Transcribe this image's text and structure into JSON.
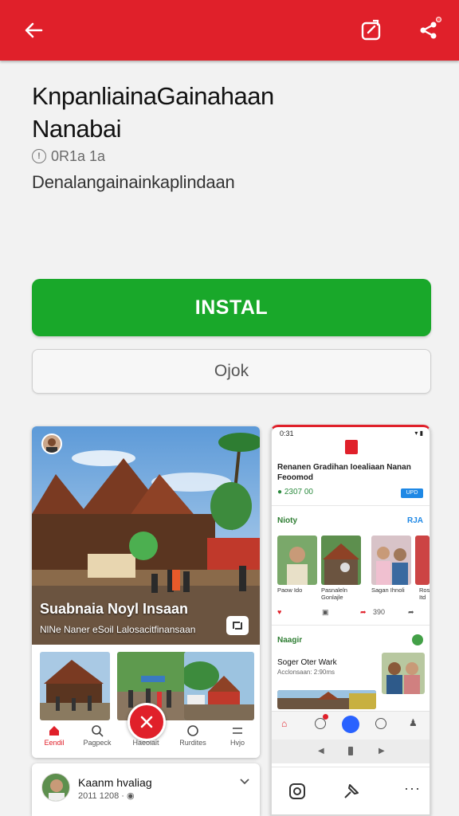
{
  "colors": {
    "accent": "#e0202a",
    "install_green": "#19a82a",
    "link_blue": "#1e88e5"
  },
  "toolbar": {
    "back_icon": "arrow-left-icon",
    "edit_icon": "edit-square-icon",
    "share_icon": "share-icon"
  },
  "app": {
    "title_line1": "KnpanliainaGainahaan",
    "title_line2": "Nanabai",
    "meta": "0R1a 1a",
    "subtitle": "Denalangainainkaplindaan"
  },
  "actions": {
    "install_label": "INSTAL",
    "open_label": "Ojok"
  },
  "screenshot1": {
    "hero_title": "Suabnaia Noyl Insaan",
    "hero_subtitle": "NlNe Naner eSoil Lalosacitfinansaan",
    "nav": [
      "Eendil",
      "Pagpeck",
      "Haeolait",
      "Rurdites",
      "Hvjo"
    ]
  },
  "screenshot2": {
    "status_time": "0:31",
    "status_right": "▾ ▮",
    "app_name": "Renanen Gradihan Ioealiaan Nanan Feoomod",
    "rating": "2307 00",
    "badge": "UPD",
    "section1": "Nioty",
    "section1_link": "RJA",
    "captions": [
      "Paow Ido",
      "Pasnaleln Gonlajle",
      "Sagan Ihnoli",
      "Rosa Itd"
    ],
    "acts_count": "390",
    "section2": "Naagir",
    "news_title": "Soger Oter Wark",
    "news_date": "Acclonsaan: 2:90ms"
  },
  "review": {
    "name": "Kaanm hvaliag",
    "date": "2011 1208 ·"
  }
}
